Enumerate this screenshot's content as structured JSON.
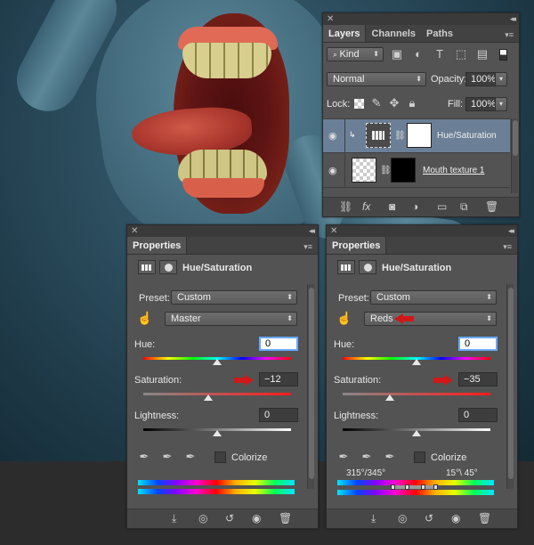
{
  "layers_panel": {
    "tabs": [
      {
        "label": "Layers"
      },
      {
        "label": "Channels"
      },
      {
        "label": "Paths"
      }
    ],
    "kind_label": "Kind",
    "blend_mode": "Normal",
    "opacity_label": "Opacity:",
    "opacity_value": "100%",
    "lock_label": "Lock:",
    "fill_label": "Fill:",
    "fill_value": "100%",
    "layers": [
      {
        "name": "Hue/Saturation"
      },
      {
        "name": "Mouth texture 1"
      }
    ]
  },
  "props_left": {
    "tab": "Properties",
    "title": "Hue/Saturation",
    "preset_label": "Preset:",
    "preset_value": "Custom",
    "range_value": "Master",
    "hue_label": "Hue:",
    "hue_value": "0",
    "saturation_label": "Saturation:",
    "saturation_value": "−12",
    "lightness_label": "Lightness:",
    "lightness_value": "0",
    "colorize_label": "Colorize"
  },
  "props_right": {
    "tab": "Properties",
    "title": "Hue/Saturation",
    "preset_label": "Preset:",
    "preset_value": "Custom",
    "range_value": "Reds",
    "hue_label": "Hue:",
    "hue_value": "0",
    "saturation_label": "Saturation:",
    "saturation_value": "−35",
    "lightness_label": "Lightness:",
    "lightness_value": "0",
    "colorize_label": "Colorize",
    "range_left": "315°/345°",
    "range_right": "15°\\ 45°"
  },
  "colors": {
    "annotation_arrow": "#d01818",
    "selected_layer": "#6b7f96"
  }
}
